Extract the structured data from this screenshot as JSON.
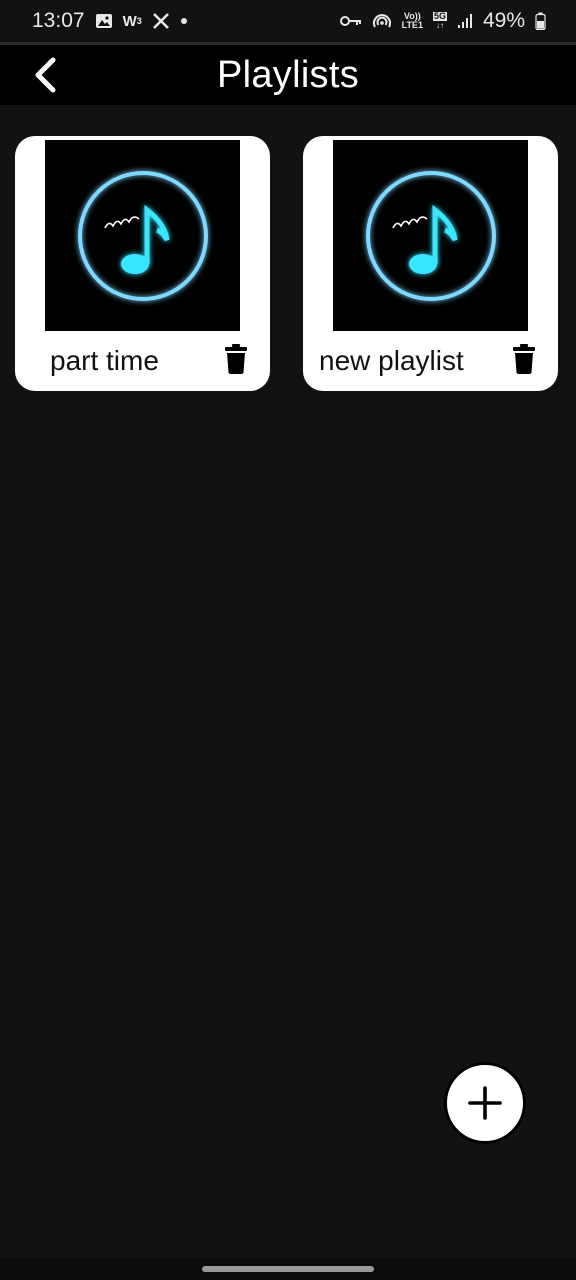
{
  "status_bar": {
    "time": "13:07",
    "left_icons": [
      "gallery-icon",
      "app-w-icon",
      "x-icon",
      "dot-icon"
    ],
    "volte_label_top": "Vo))",
    "volte_label_bottom": "LTE1",
    "network_label": "5G",
    "battery_percent": "49%"
  },
  "app_bar": {
    "title": "Playlists",
    "back_icon": "chevron-left-icon"
  },
  "playlists": [
    {
      "name": "part time",
      "artwork_icon": "neon-music-note-icon",
      "delete_icon": "trash-icon"
    },
    {
      "name": "new playlist",
      "artwork_icon": "neon-music-note-icon",
      "delete_icon": "trash-icon"
    }
  ],
  "fab": {
    "icon": "plus-icon"
  },
  "colors": {
    "background": "#121212",
    "app_bar": "#000000",
    "card": "#ffffff",
    "neon_ring": "#7fd8ff",
    "neon_note": "#39e6ff"
  }
}
